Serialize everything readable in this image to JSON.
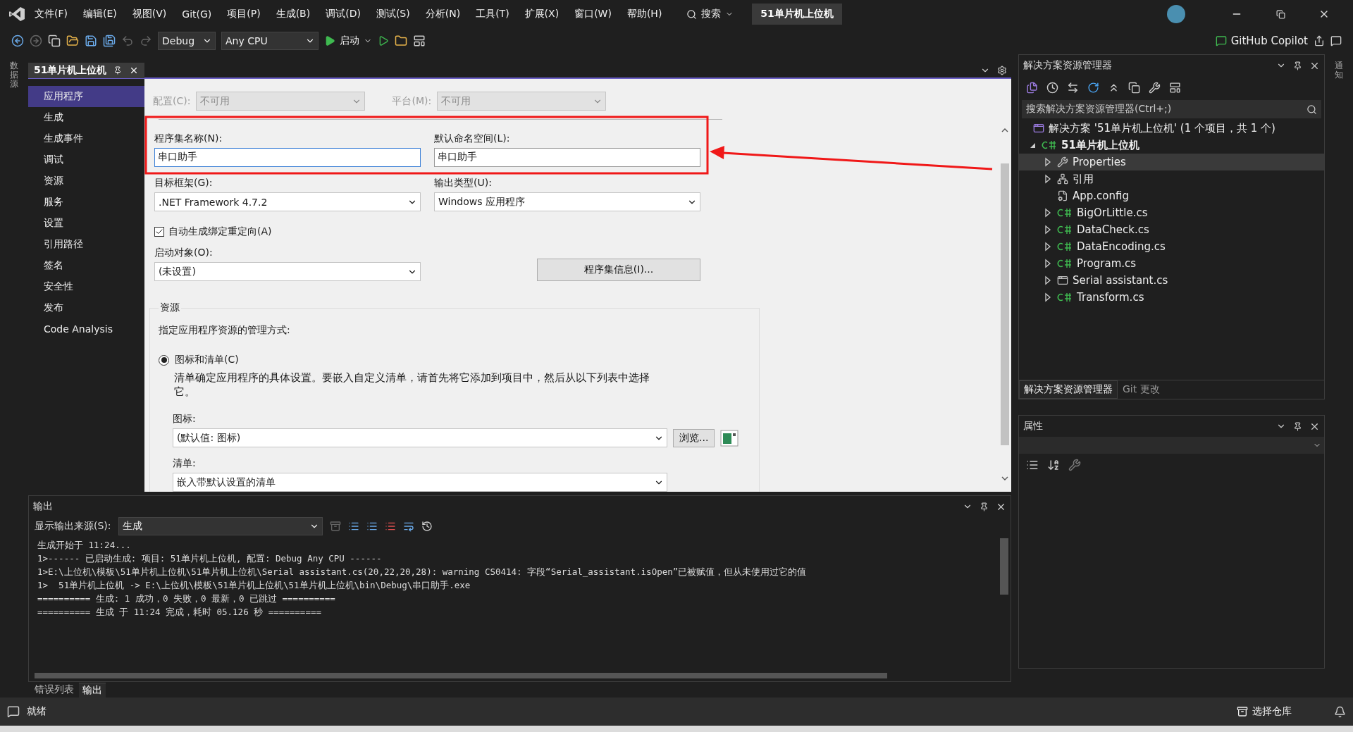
{
  "menu": {
    "items": [
      "文件(F)",
      "编辑(E)",
      "视图(V)",
      "Git(G)",
      "项目(P)",
      "生成(B)",
      "调试(D)",
      "测试(S)",
      "分析(N)",
      "工具(T)",
      "扩展(X)",
      "窗口(W)",
      "帮助(H)"
    ],
    "search": "搜索",
    "project_badge": "51单片机上位机"
  },
  "toolbar": {
    "configuration": "Debug",
    "platform": "Any CPU",
    "start": "启动",
    "copilot": "GitHub Copilot"
  },
  "left_strip": {
    "label": "数据源"
  },
  "right_strip": {
    "label": "通知"
  },
  "document_tab": {
    "title": "51单片机上位机"
  },
  "nav": [
    {
      "label": "应用程序",
      "selected": true
    },
    {
      "label": "生成",
      "selected": false
    },
    {
      "label": "生成事件",
      "selected": false
    },
    {
      "label": "调试",
      "selected": false
    },
    {
      "label": "资源",
      "selected": false
    },
    {
      "label": "服务",
      "selected": false
    },
    {
      "label": "设置",
      "selected": false
    },
    {
      "label": "引用路径",
      "selected": false
    },
    {
      "label": "签名",
      "selected": false
    },
    {
      "label": "安全性",
      "selected": false
    },
    {
      "label": "发布",
      "selected": false
    },
    {
      "label": "Code Analysis",
      "selected": false
    }
  ],
  "page": {
    "config_label": "配置(C):",
    "config_value": "不可用",
    "platform_label": "平台(M):",
    "platform_value": "不可用",
    "assembly_label": "程序集名称(N):",
    "assembly_value": "串口助手",
    "namespace_label": "默认命名空间(L):",
    "namespace_value": "串口助手",
    "framework_label": "目标框架(G):",
    "framework_value": ".NET Framework 4.7.2",
    "output_type_label": "输出类型(U):",
    "output_type_value": "Windows 应用程序",
    "auto_redirect": {
      "label": "自动生成绑定重定向(A)",
      "checked": true
    },
    "startup_label": "启动对象(O):",
    "startup_value": "(未设置)",
    "assembly_info_button": "程序集信息(I)...",
    "resources": {
      "title": "资源",
      "intro": "指定应用程序资源的管理方式:",
      "option": {
        "label": "图标和清单(C)",
        "selected": true
      },
      "description": "清单确定应用程序的具体设置。要嵌入自定义清单，请首先将它添加到项目中，然后从以下列表中选择它。",
      "icon_label": "图标:",
      "icon_value": "(默认值: 图标)",
      "browse_button": "浏览...",
      "manifest_label": "清单:",
      "manifest_value": "嵌入带默认设置的清单"
    }
  },
  "solution_explorer": {
    "title": "解决方案资源管理器",
    "search_placeholder": "搜索解决方案资源管理器(Ctrl+;)",
    "solution": "解决方案 '51单片机上位机' (1 个项目，共 1 个)",
    "project": {
      "label": "51单片机上位机",
      "expanded": true,
      "children": [
        {
          "kind": "properties",
          "label": "Properties",
          "expandable": true,
          "selected": true
        },
        {
          "kind": "references",
          "label": "引用",
          "expandable": true,
          "selected": false
        },
        {
          "kind": "config",
          "label": "App.config",
          "expandable": false,
          "selected": false
        },
        {
          "kind": "csharp",
          "label": "BigOrLittle.cs",
          "expandable": true,
          "selected": false
        },
        {
          "kind": "csharp",
          "label": "DataCheck.cs",
          "expandable": true,
          "selected": false
        },
        {
          "kind": "csharp",
          "label": "DataEncoding.cs",
          "expandable": true,
          "selected": false
        },
        {
          "kind": "csharp",
          "label": "Program.cs",
          "expandable": true,
          "selected": false
        },
        {
          "kind": "form",
          "label": "Serial assistant.cs",
          "expandable": true,
          "selected": false
        },
        {
          "kind": "csharp",
          "label": "Transform.cs",
          "expandable": true,
          "selected": false
        }
      ]
    },
    "tabs": [
      {
        "label": "解决方案资源管理器",
        "selected": true
      },
      {
        "label": "Git 更改",
        "selected": false
      }
    ]
  },
  "properties_panel": {
    "title": "属性"
  },
  "output": {
    "title": "输出",
    "source_label": "显示输出来源(S):",
    "source_value": "生成",
    "lines": [
      "生成开始于 11:24...",
      "1>------ 已启动生成: 项目: 51单片机上位机, 配置: Debug Any CPU ------",
      "1>E:\\上位机\\模板\\51单片机上位机\\51单片机上位机\\Serial assistant.cs(20,22,20,28): warning CS0414: 字段“Serial_assistant.isOpen”已被赋值，但从未使用过它的值",
      "1>  51单片机上位机 -> E:\\上位机\\模板\\51单片机上位机\\51单片机上位机\\bin\\Debug\\串口助手.exe",
      "========== 生成: 1 成功，0 失败，0 最新，0 已跳过 ==========",
      "========== 生成 于 11:24 完成，耗时 05.126 秒 =========="
    ],
    "tabs": [
      {
        "label": "错误列表",
        "selected": false
      },
      {
        "label": "输出",
        "selected": true
      }
    ]
  },
  "status_bar": {
    "message": "就绪",
    "repository": "选择仓库"
  }
}
